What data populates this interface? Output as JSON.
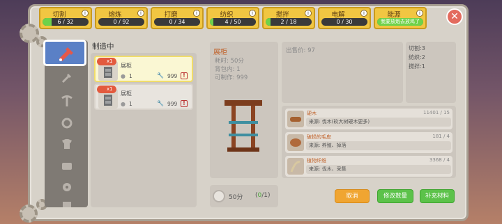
{
  "close_label": "✕",
  "tabs": [
    {
      "name": "切割",
      "progress": "6 / 32",
      "fraction": 0.19
    },
    {
      "name": "熔炼",
      "progress": "0 / 92",
      "fraction": 0
    },
    {
      "name": "打磨",
      "progress": "0 / 34",
      "fraction": 0
    },
    {
      "name": "纺织",
      "progress": "4 / 50",
      "fraction": 0.08
    },
    {
      "name": "搅拌",
      "progress": "2 / 18",
      "fraction": 0.11
    },
    {
      "name": "电解",
      "progress": "0 / 30",
      "fraction": 0
    },
    {
      "name": "能源",
      "progress": "我要放炮去放鸡了",
      "fraction": 1.0
    }
  ],
  "tab_info_icon": "i",
  "list": {
    "title": "制造中",
    "cards": [
      {
        "qty": "x1",
        "name": "展柜",
        "count1": "1",
        "count2": "999",
        "warn": "!"
      },
      {
        "qty": "x1",
        "name": "展柜",
        "count1": "1",
        "count2": "999",
        "warn": "!"
      }
    ]
  },
  "detail": {
    "name": "展柜",
    "time": "耗时: 50分",
    "bag": "背包内: 1",
    "makeable": "可制作: 999"
  },
  "info": {
    "price": "出售价: 97"
  },
  "requirements": [
    "切割:3",
    "纺织:2",
    "搅拌:1"
  ],
  "materials": [
    {
      "name": "硬木",
      "count": "11401 / 15",
      "source": "来源: 伐木(砍大树硬木更多)"
    },
    {
      "name": "破损的毛皮",
      "count": "181 / 4",
      "source": "来源: 养殖、掉落"
    },
    {
      "name": "植物纤维",
      "count": "3368 / 4",
      "source": "来源: 伐木、采集"
    }
  ],
  "bottom": {
    "time": "50分",
    "queue_open": "(",
    "queue_current": "0",
    "queue_close": "/1)"
  },
  "buttons": {
    "cancel": "取消",
    "modify": "修改数量",
    "supply": "补充材料"
  },
  "colors": {
    "tab": "#f1c642",
    "progress": "#6fd24a",
    "cancel": "#f0a531",
    "action": "#5cc24a",
    "close": "#e36b5e",
    "active_sidebar": "#5a80c6"
  }
}
